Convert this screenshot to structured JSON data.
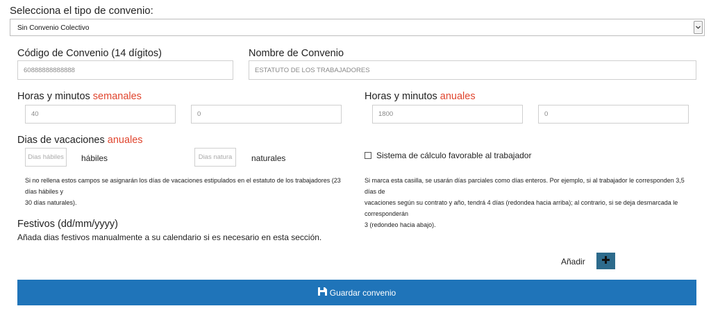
{
  "convenio_type": {
    "heading": "Selecciona el tipo de convenio:",
    "selected": "Sin Convenio Colectivo"
  },
  "codigo": {
    "label": "Código de Convenio (14 dígitos)",
    "value": "60888888888888"
  },
  "nombre": {
    "label": "Nombre de Convenio",
    "value": "ESTATUTO DE LOS TRABAJADORES"
  },
  "horas_semanales": {
    "label_prefix": "Horas y minutos ",
    "label_accent": "semanales",
    "hours_value": "40",
    "minutes_value": "0"
  },
  "horas_anuales": {
    "label_prefix": "Horas y minutos ",
    "label_accent": "anuales",
    "hours_value": "1800",
    "minutes_value": "0"
  },
  "vacaciones": {
    "label_prefix": "Dias de vacaciones ",
    "label_accent": "anuales",
    "habiles_placeholder": "Dias hábiles",
    "habiles_label": "hábiles",
    "naturales_placeholder": "Dias natura",
    "naturales_label": "naturales",
    "note_line1": "Si no rellena estos campos se asignarán los días de vacaciones estipulados en el estatuto de los trabajadores (23 días hábiles y",
    "note_line2": "30 días naturales)."
  },
  "sistema_calculo": {
    "label": "Sistema de cálculo favorable al trabajador",
    "checked": false,
    "note_line1": "Si marca esta casilla, se usarán días parciales como días enteros. Por ejemplo, si al trabajador le corresponden 3,5 días de",
    "note_line2": "vacaciones según su contrato y año, tendrá 4 días (redondea hacia arriba); al contrario, si se deja desmarcada le corresponderán",
    "note_line3": "3 (redondeo hacia abajo)."
  },
  "festivos": {
    "label": "Festivos (dd/mm/yyyy)",
    "description": "Añada dias festivos manualmente a su calendario si es necesario en esta sección.",
    "add_label": "Añadir",
    "add_icon": "plus-icon"
  },
  "save": {
    "label": "Guardar convenio",
    "icon": "save-icon"
  },
  "colors": {
    "accent": "#e0452e",
    "primary_button": "#1f74b9",
    "add_button": "#2d6b8c"
  }
}
